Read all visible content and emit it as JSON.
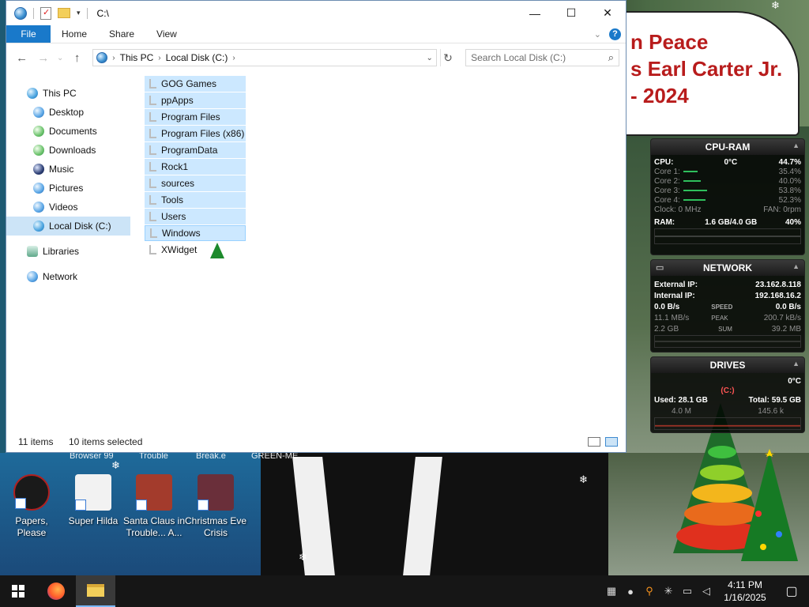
{
  "window": {
    "title": "C:\\",
    "controls": {
      "minimize": "—",
      "maximize": "☐",
      "close": "✕"
    }
  },
  "ribbon": {
    "tabs": [
      "File",
      "Home",
      "Share",
      "View"
    ]
  },
  "address": {
    "crumbs": [
      "This PC",
      "Local Disk (C:)"
    ],
    "search_placeholder": "Search Local Disk (C:)"
  },
  "nav_pane": {
    "items": [
      {
        "label": "This PC",
        "icon": "computer-icon"
      },
      {
        "label": "Desktop",
        "icon": "desktop-icon"
      },
      {
        "label": "Documents",
        "icon": "documents-icon"
      },
      {
        "label": "Downloads",
        "icon": "downloads-icon"
      },
      {
        "label": "Music",
        "icon": "music-icon"
      },
      {
        "label": "Pictures",
        "icon": "pictures-icon"
      },
      {
        "label": "Videos",
        "icon": "videos-icon"
      },
      {
        "label": "Local Disk (C:)",
        "icon": "drive-icon",
        "selected": true
      },
      {
        "label": "Libraries",
        "icon": "libraries-icon"
      },
      {
        "label": "Network",
        "icon": "network-icon"
      }
    ]
  },
  "files": [
    {
      "name": "GOG Games",
      "selected": true
    },
    {
      "name": "ppApps",
      "selected": true
    },
    {
      "name": "Program Files",
      "selected": true
    },
    {
      "name": "Program Files (x86)",
      "selected": true
    },
    {
      "name": "ProgramData",
      "selected": true
    },
    {
      "name": "Rock1",
      "selected": true
    },
    {
      "name": "sources",
      "selected": true
    },
    {
      "name": "Tools",
      "selected": true
    },
    {
      "name": "Users",
      "selected": true
    },
    {
      "name": "Windows",
      "selected": true
    },
    {
      "name": "XWidget",
      "selected": false
    }
  ],
  "status": {
    "items": "11 items",
    "selected": "10 items selected"
  },
  "banner": {
    "lines": [
      "n Peace",
      "s Earl Carter Jr.",
      "- 2024"
    ]
  },
  "gadgets": {
    "cpu": {
      "title": "CPU-RAM",
      "cpu_label": "CPU:",
      "temp": "0°C",
      "cpu_pct": "44.7%",
      "cores": [
        {
          "label": "Core 1:",
          "value": "35.4%",
          "level": 0.354
        },
        {
          "label": "Core 2:",
          "value": "40.0%",
          "level": 0.4
        },
        {
          "label": "Core 3:",
          "value": "53.8%",
          "level": 0.538
        },
        {
          "label": "Core 4:",
          "value": "52.3%",
          "level": 0.523
        }
      ],
      "clock": "Clock: 0 MHz",
      "fan": "FAN: 0rpm",
      "ram_label": "RAM:",
      "ram": "1.6 GB/4.0 GB",
      "ram_pct": "40%"
    },
    "network": {
      "title": "NETWORK",
      "ext_label": "External IP:",
      "ext_ip": "23.162.8.118",
      "int_label": "Internal IP:",
      "int_ip": "192.168.16.2",
      "speed_left": "0.0 B/s",
      "speed_mid": "SPEED",
      "speed_right": "0.0 B/s",
      "peak_left": "11.1 MB/s",
      "peak_mid": "PEAK",
      "peak_right": "200.7 kB/s",
      "sum_left": "2.2 GB",
      "sum_mid": "SUM",
      "sum_right": "39.2 MB"
    },
    "drives": {
      "title": "DRIVES",
      "temp": "0°C",
      "drive": "(C:)",
      "used": "Used: 28.1 GB",
      "total": "Total: 59.5 GB",
      "read": "4.0 M",
      "write": "145.6 k"
    }
  },
  "desktop": {
    "partial_labels": [
      "Browser 99",
      "Trouble",
      "Break.e",
      "GREEN-ME"
    ],
    "icons": [
      {
        "label": "Papers, Please",
        "color": "#1a1a1a"
      },
      {
        "label": "Super Hilda",
        "color": "#f2f2f2"
      },
      {
        "label": "Santa Claus in Trouble... A...",
        "color": "#a33b2c"
      },
      {
        "label": "Christmas Eve Crisis",
        "color": "#6a2f3a"
      }
    ]
  },
  "taskbar": {
    "time": "4:11 PM",
    "date": "1/16/2025"
  },
  "colors": {
    "accent": "#1979ca",
    "selection": "#cce8ff",
    "banner_text": "#b81c1c"
  }
}
